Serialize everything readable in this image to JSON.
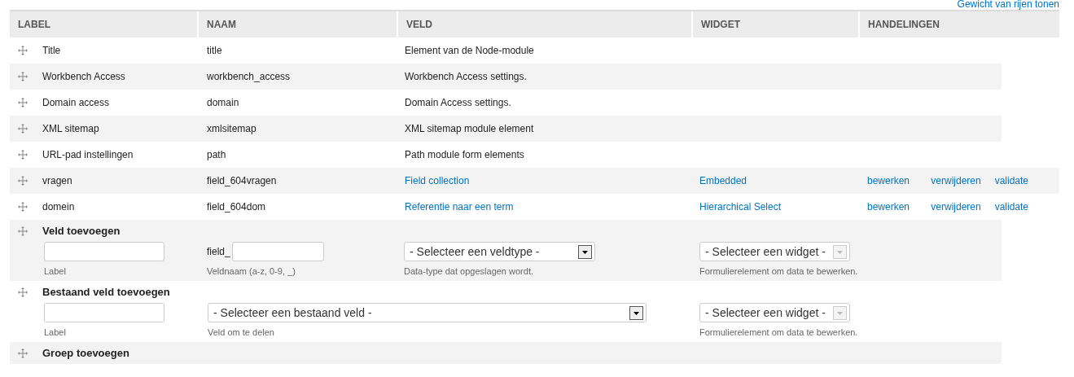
{
  "top_link": "Gewicht van rijen tonen",
  "columns": [
    "LABEL",
    "NAAM",
    "VELD",
    "WIDGET",
    "HANDELINGEN"
  ],
  "rows": [
    {
      "label": "Title",
      "name": "title",
      "field": "Element van de Node-module",
      "field_link": false
    },
    {
      "label": "Workbench Access",
      "name": "workbench_access",
      "field": "Workbench Access settings.",
      "field_link": false
    },
    {
      "label": "Domain access",
      "name": "domain",
      "field": "Domain Access settings.",
      "field_link": false
    },
    {
      "label": "XML sitemap",
      "name": "xmlsitemap",
      "field": "XML sitemap module element",
      "field_link": false
    },
    {
      "label": "URL-pad instellingen",
      "name": "path",
      "field": "Path module form elements",
      "field_link": false
    },
    {
      "label": "vragen",
      "name": "field_604vragen",
      "field": "Field collection",
      "field_link": true,
      "widget": "Embedded",
      "actions": [
        "bewerken",
        "verwijderen",
        "validate"
      ]
    },
    {
      "label": "domein",
      "name": "field_604dom",
      "field": "Referentie naar een term",
      "field_link": true,
      "widget": "Hierarchical Select",
      "actions": [
        "bewerken",
        "verwijderen",
        "validate"
      ]
    }
  ],
  "add_sections": [
    {
      "kind": "new",
      "title": "Veld toevoegen",
      "label_hint": "Label",
      "prefix": "field_",
      "name_hint": "Veldnaam (a-z, 0-9, _)",
      "type_select": "- Selecteer een veldtype -",
      "type_hint": "Data-type dat opgeslagen wordt.",
      "widget_select": "- Selecteer een widget -",
      "widget_hint": "Formulierelement om data te bewerken."
    },
    {
      "kind": "existing",
      "title": "Bestaand veld toevoegen",
      "label_hint": "Label",
      "field_select": "- Selecteer een bestaand veld -",
      "field_hint": "Veld om te delen",
      "widget_select": "- Selecteer een widget -",
      "widget_hint": "Formulierelement om data te bewerken."
    },
    {
      "kind": "group",
      "title": "Groep toevoegen"
    }
  ]
}
